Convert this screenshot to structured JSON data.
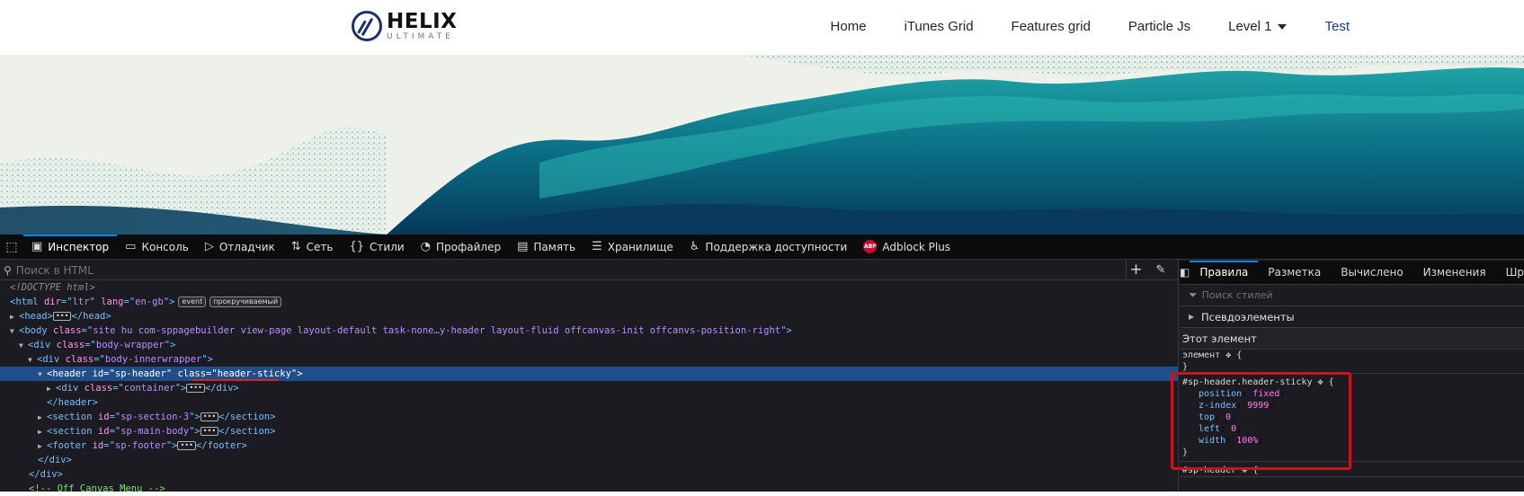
{
  "site": {
    "logo_title": "HELIX",
    "logo_subtitle": "ULTIMATE",
    "nav": [
      "Home",
      "iTunes Grid",
      "Features grid",
      "Particle Js",
      "Level 1",
      "Test"
    ]
  },
  "devtools": {
    "tabs": [
      {
        "icon": "inspector-icon",
        "label": "Инспектор"
      },
      {
        "icon": "console-icon",
        "label": "Консоль"
      },
      {
        "icon": "debugger-icon",
        "label": "Отладчик"
      },
      {
        "icon": "network-icon",
        "label": "Сеть"
      },
      {
        "icon": "style-editor-icon",
        "label": "Стили"
      },
      {
        "icon": "profiler-icon",
        "label": "Профайлер"
      },
      {
        "icon": "memory-icon",
        "label": "Память"
      },
      {
        "icon": "storage-icon",
        "label": "Хранилище"
      },
      {
        "icon": "accessibility-icon",
        "label": "Поддержка доступности"
      },
      {
        "icon": "adblock-icon",
        "label": "Adblock Plus"
      }
    ],
    "abp_text": "ABP",
    "html_search_placeholder": "Поиск в HTML",
    "tree": {
      "doctype": "<!DOCTYPE html>",
      "html_tag": "html",
      "html_dir": "ltr",
      "html_lang": "en-gb",
      "badge_event": "event",
      "badge_scroll": "прокручиваемый",
      "head": "head",
      "body_class": "site hu com-sppagebuilder view-page layout-default task-none…y-header layout-fluid offcanvas-init offcanvs-position-right",
      "div_body_wrapper": "body-wrapper",
      "div_body_innerwrapper": "body-innerwrapper",
      "header_id": "sp-header",
      "header_class": "header-sticky",
      "container_class": "container",
      "section1_id": "sp-section-3",
      "section2_id": "sp-main-body",
      "footer_id": "sp-footer",
      "comment": "<!-- Off Canvas Menu -->"
    },
    "rules_tabs": [
      "Правила",
      "Разметка",
      "Вычислено",
      "Изменения",
      "Шрифты"
    ],
    "styles_filter_placeholder": "Поиск стилей",
    "pseudo_elements": "Псевдоэлементы",
    "this_element": "Этот элемент",
    "element_rule": "элемент",
    "rule_selector": "#sp-header.header-sticky",
    "rule_decls": [
      {
        "prop": "position",
        "val": "fixed"
      },
      {
        "prop": "z-index",
        "val": "9999"
      },
      {
        "prop": "top",
        "val": "0"
      },
      {
        "prop": "left",
        "val": "0"
      },
      {
        "prop": "width",
        "val": "100%"
      }
    ],
    "next_selector": "#sp-header",
    "highlight_color": "#c6161d"
  }
}
